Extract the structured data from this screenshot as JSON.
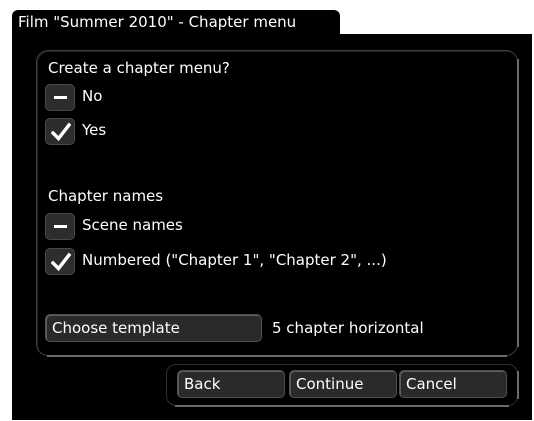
{
  "window": {
    "title": "Film \"Summer 2010\" - Chapter menu"
  },
  "create_menu": {
    "heading": "Create a chapter menu?",
    "options": [
      {
        "label": "No",
        "state": "unchecked",
        "icon": "dash-icon"
      },
      {
        "label": "Yes",
        "state": "checked",
        "icon": "checkmark-icon"
      }
    ]
  },
  "chapter_names": {
    "heading": "Chapter names",
    "options": [
      {
        "label": "Scene names",
        "state": "unchecked",
        "icon": "dash-icon"
      },
      {
        "label": "Numbered (\"Chapter 1\", \"Chapter 2\", ...)",
        "state": "checked",
        "icon": "checkmark-icon"
      }
    ]
  },
  "template": {
    "button_label": "Choose template",
    "value": "5 chapter horizontal"
  },
  "footer": {
    "back_label": "Back",
    "continue_label": "Continue",
    "cancel_label": "Cancel"
  },
  "colors": {
    "background": "#000000",
    "control": "#2a2a2a",
    "text": "#ffffff"
  }
}
